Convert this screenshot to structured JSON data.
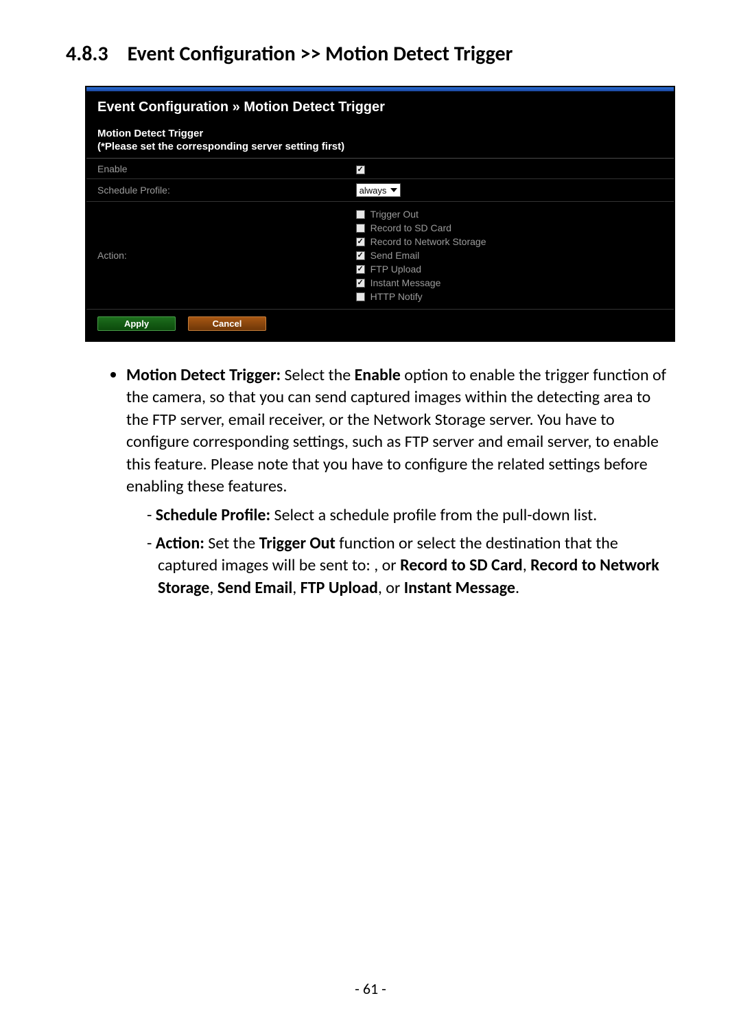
{
  "heading": {
    "number": "4.8.3",
    "title": "Event Configuration >> Motion Detect Trigger"
  },
  "panel": {
    "breadcrumb": "Event Configuration » Motion Detect Trigger",
    "subheader": {
      "title": "Motion Detect Trigger",
      "note": "(*Please set the corresponding server setting first)"
    },
    "rows": {
      "enable": {
        "label": "Enable",
        "checked": true
      },
      "schedule": {
        "label": "Schedule Profile:",
        "value": "always"
      },
      "action": {
        "label": "Action:",
        "items": [
          {
            "label": "Trigger Out",
            "checked": false
          },
          {
            "label": "Record to SD Card",
            "checked": false
          },
          {
            "label": "Record to Network Storage",
            "checked": true
          },
          {
            "label": "Send Email",
            "checked": true
          },
          {
            "label": "FTP Upload",
            "checked": true
          },
          {
            "label": "Instant Message",
            "checked": true
          },
          {
            "label": "HTTP Notify",
            "checked": false
          }
        ]
      }
    },
    "buttons": {
      "apply": "Apply",
      "cancel": "Cancel"
    }
  },
  "doc": {
    "bullet_lead": "Motion Detect Trigger:",
    "bullet_body_1": " Select the ",
    "bullet_bold_enable": "Enable",
    "bullet_body_2": " option to enable the trigger function of the camera, so that you can send captured images within the detecting area to the FTP server, email receiver, or the Network Storage server. You have to configure corresponding settings, such as FTP server and email server, to enable this feature. Please note that you have to configure the related settings before enabling these features.",
    "sub1_lead": "Schedule Profile:",
    "sub1_body": " Select a schedule profile from the pull-down list.",
    "sub2_lead": "Action:",
    "sub2_body_1": " Set the ",
    "sub2_bold_trigger": "Trigger Out",
    "sub2_body_2": " function or select the destination that the captured images will be sent to: , or ",
    "sub2_bold_sd": "Record to SD Card",
    "sub2_sep1": ", ",
    "sub2_bold_net": "Record to Network Storage",
    "sub2_sep2": ", ",
    "sub2_bold_email": "Send Email",
    "sub2_sep3": ", ",
    "sub2_bold_ftp": "FTP Upload",
    "sub2_sep4": ", or ",
    "sub2_bold_im": "Instant Message",
    "sub2_period": "."
  },
  "page_number": "- 61 -"
}
